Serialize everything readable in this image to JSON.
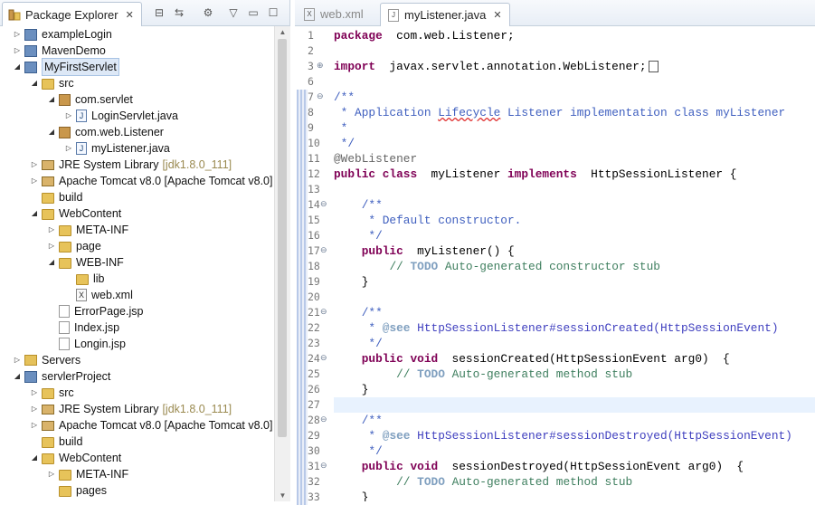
{
  "explorer": {
    "tab_title": "Package Explorer",
    "tree": [
      {
        "label": "exampleLogin",
        "depth": 0,
        "arrow": "▷",
        "icon": "proj"
      },
      {
        "label": "MavenDemo",
        "depth": 0,
        "arrow": "▷",
        "icon": "proj"
      },
      {
        "label": "MyFirstServlet",
        "depth": 0,
        "arrow": "◢",
        "icon": "proj",
        "selected": true
      },
      {
        "label": "src",
        "depth": 1,
        "arrow": "◢",
        "icon": "folder"
      },
      {
        "label": "com.servlet",
        "depth": 2,
        "arrow": "◢",
        "icon": "pkg"
      },
      {
        "label": "LoginServlet.java",
        "depth": 3,
        "arrow": "▷",
        "icon": "jfile"
      },
      {
        "label": "com.web.Listener",
        "depth": 2,
        "arrow": "◢",
        "icon": "pkg"
      },
      {
        "label": "myListener.java",
        "depth": 3,
        "arrow": "▷",
        "icon": "jfile"
      },
      {
        "label": "JRE System Library",
        "suffix": "[jdk1.8.0_111]",
        "depth": 1,
        "arrow": "▷",
        "icon": "lib"
      },
      {
        "label": "Apache Tomcat v8.0 [Apache Tomcat v8.0]",
        "depth": 1,
        "arrow": "▷",
        "icon": "lib"
      },
      {
        "label": "build",
        "depth": 1,
        "arrow": "",
        "icon": "folder"
      },
      {
        "label": "WebContent",
        "depth": 1,
        "arrow": "◢",
        "icon": "folder"
      },
      {
        "label": "META-INF",
        "depth": 2,
        "arrow": "▷",
        "icon": "folder"
      },
      {
        "label": "page",
        "depth": 2,
        "arrow": "▷",
        "icon": "folder"
      },
      {
        "label": "WEB-INF",
        "depth": 2,
        "arrow": "◢",
        "icon": "folder"
      },
      {
        "label": "lib",
        "depth": 3,
        "arrow": "",
        "icon": "folder"
      },
      {
        "label": "web.xml",
        "depth": 3,
        "arrow": "",
        "icon": "xfile"
      },
      {
        "label": "ErrorPage.jsp",
        "depth": 2,
        "arrow": "",
        "icon": "jspfile"
      },
      {
        "label": "Index.jsp",
        "depth": 2,
        "arrow": "",
        "icon": "jspfile"
      },
      {
        "label": "Longin.jsp",
        "depth": 2,
        "arrow": "",
        "icon": "jspfile"
      },
      {
        "label": "Servers",
        "depth": 0,
        "arrow": "▷",
        "icon": "srv"
      },
      {
        "label": "servlerProject",
        "depth": 0,
        "arrow": "◢",
        "icon": "proj"
      },
      {
        "label": "src",
        "depth": 1,
        "arrow": "▷",
        "icon": "folder"
      },
      {
        "label": "JRE System Library",
        "suffix": "[jdk1.8.0_111]",
        "depth": 1,
        "arrow": "▷",
        "icon": "lib"
      },
      {
        "label": "Apache Tomcat v8.0 [Apache Tomcat v8.0]",
        "depth": 1,
        "arrow": "▷",
        "icon": "lib"
      },
      {
        "label": "build",
        "depth": 1,
        "arrow": "",
        "icon": "folder"
      },
      {
        "label": "WebContent",
        "depth": 1,
        "arrow": "◢",
        "icon": "folder"
      },
      {
        "label": "META-INF",
        "depth": 2,
        "arrow": "▷",
        "icon": "folder"
      },
      {
        "label": "pages",
        "depth": 2,
        "arrow": "",
        "icon": "folder"
      }
    ]
  },
  "editor": {
    "tabs": [
      {
        "label": "web.xml",
        "active": false,
        "icon": "X"
      },
      {
        "label": "myListener.java",
        "active": true,
        "icon": "J"
      }
    ],
    "line_numbers": [
      "1",
      "2",
      "3",
      "6",
      "7",
      "8",
      "9",
      "10",
      "11",
      "12",
      "13",
      "14",
      "15",
      "16",
      "17",
      "18",
      "19",
      "20",
      "21",
      "22",
      "23",
      "24",
      "25",
      "26",
      "27",
      "28",
      "29",
      "30",
      "31",
      "32",
      "33"
    ],
    "code": [
      [
        [
          "kw",
          "package"
        ],
        [
          "",
          "  com.web.Listener;"
        ]
      ],
      [],
      [
        [
          "kw",
          "import"
        ],
        [
          "",
          "  javax.servlet.annotation.WebListener;"
        ]
      ],
      [],
      [
        [
          "cm",
          "/**"
        ]
      ],
      [
        [
          "cm",
          " * Application "
        ],
        [
          "cm sq",
          "Lifecycle"
        ],
        [
          "cm",
          " Listener implementation class myListener"
        ]
      ],
      [
        [
          "cm",
          " *"
        ]
      ],
      [
        [
          "cm",
          " */"
        ]
      ],
      [
        [
          "ann",
          "@WebListener"
        ]
      ],
      [
        [
          "kw",
          "public class"
        ],
        [
          "",
          "  myListener "
        ],
        [
          "kw",
          "implements"
        ],
        [
          "",
          "  HttpSessionListener {"
        ]
      ],
      [],
      [
        [
          "",
          "    "
        ],
        [
          "cm",
          "/**"
        ]
      ],
      [
        [
          "",
          "    "
        ],
        [
          "cm",
          " * Default constructor."
        ]
      ],
      [
        [
          "",
          "    "
        ],
        [
          "cm",
          " */"
        ]
      ],
      [
        [
          "",
          "    "
        ],
        [
          "kw",
          "public"
        ],
        [
          "",
          "  myListener() {"
        ]
      ],
      [
        [
          "",
          "        "
        ],
        [
          "cmg",
          "// "
        ],
        [
          "todo",
          "TODO"
        ],
        [
          "cmg",
          " Auto-generated constructor stub"
        ]
      ],
      [
        [
          "",
          "    }"
        ]
      ],
      [],
      [
        [
          "",
          "    "
        ],
        [
          "cm",
          "/**"
        ]
      ],
      [
        [
          "",
          "     "
        ],
        [
          "cm",
          "* "
        ],
        [
          "tag",
          "@see"
        ],
        [
          "cm",
          " "
        ],
        [
          "lnk",
          "HttpSessionListener#sessionCreated(HttpSessionEvent)"
        ]
      ],
      [
        [
          "",
          "    "
        ],
        [
          "cm",
          " */"
        ]
      ],
      [
        [
          "",
          "    "
        ],
        [
          "kw",
          "public void"
        ],
        [
          "",
          "  sessionCreated(HttpSessionEvent arg0)  {"
        ]
      ],
      [
        [
          "",
          "         "
        ],
        [
          "cmg",
          "// "
        ],
        [
          "todo",
          "TODO"
        ],
        [
          "cmg",
          " Auto-generated method stub"
        ]
      ],
      [
        [
          "",
          "    }"
        ]
      ],
      [],
      [
        [
          "",
          "    "
        ],
        [
          "cm",
          "/**"
        ]
      ],
      [
        [
          "",
          "     "
        ],
        [
          "cm",
          "* "
        ],
        [
          "tag",
          "@see"
        ],
        [
          "cm",
          " "
        ],
        [
          "lnk",
          "HttpSessionListener#sessionDestroyed(HttpSessionEvent)"
        ]
      ],
      [
        [
          "",
          "    "
        ],
        [
          "cm",
          " */"
        ]
      ],
      [
        [
          "",
          "    "
        ],
        [
          "kw",
          "public void"
        ],
        [
          "",
          "  sessionDestroyed(HttpSessionEvent arg0)  {"
        ]
      ],
      [
        [
          "",
          "         "
        ],
        [
          "cmg",
          "// "
        ],
        [
          "todo",
          "TODO"
        ],
        [
          "cmg",
          " Auto-generated method stub"
        ]
      ],
      [
        [
          "",
          "    }"
        ]
      ]
    ],
    "highlight_line_index": 24
  }
}
